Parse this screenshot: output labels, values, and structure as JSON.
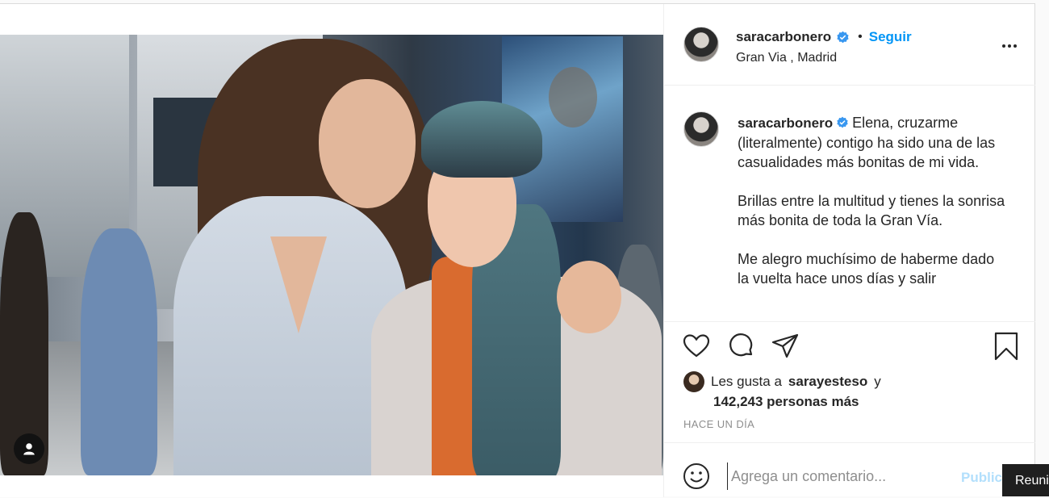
{
  "post": {
    "username": "saracarbonero",
    "verified": true,
    "separator": "•",
    "follow_label": "Seguir",
    "location": "Gran Via , Madrid",
    "caption_paragraphs": [
      "Elena, cruzarme (literalmente) contigo ha sido una de las casualidades más bonitas de mi vida.",
      "Brillas entre la multitud y tienes la sonrisa más bonita de toda la Gran Vía.",
      "Me alegro muchísimo de haberme dado la vuelta hace unos días y salir"
    ],
    "likes": {
      "prefix": "Les gusta a",
      "first_user": "sarayesteso",
      "conjunction": "y",
      "others": "142,243 personas más"
    },
    "timestamp": "HACE UN DÍA"
  },
  "comment": {
    "placeholder": "Agrega un comentario...",
    "publish_label": "Publicar"
  },
  "notification": {
    "text": "Reunión"
  },
  "icons": {
    "tag": "user-tag-icon",
    "verified": "verified-badge-icon",
    "more": "more-options-icon",
    "like": "heart-icon",
    "comment": "comment-bubble-icon",
    "share": "paper-plane-icon",
    "save": "bookmark-icon",
    "emoji": "emoji-smile-icon"
  },
  "colors": {
    "accent": "#0095f6",
    "publish_disabled": "#b2dffc",
    "verified": "#3897f0",
    "muted": "#8e8e8e"
  }
}
